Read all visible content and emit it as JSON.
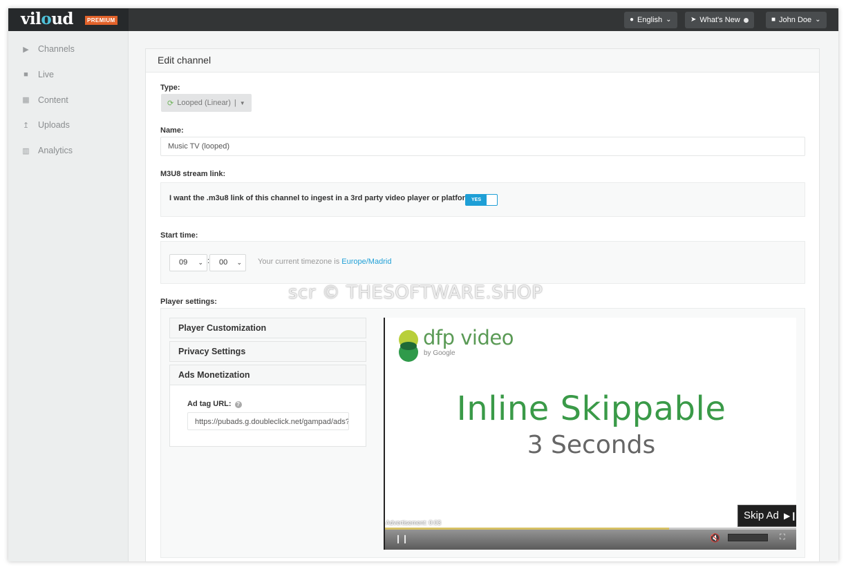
{
  "header": {
    "logo_text_1": "vil",
    "logo_text_2": "o",
    "logo_text_3": "ud",
    "premium_badge": "PREMIUM",
    "language_label": "English",
    "whats_new_label": "What's New",
    "user_label": "John Doe"
  },
  "sidebar": {
    "items": [
      {
        "label": "Channels",
        "icon": "play-icon"
      },
      {
        "label": "Live",
        "icon": "video-camera-icon"
      },
      {
        "label": "Content",
        "icon": "grid-icon"
      },
      {
        "label": "Uploads",
        "icon": "upload-icon"
      },
      {
        "label": "Analytics",
        "icon": "bar-chart-icon"
      }
    ]
  },
  "form": {
    "title": "Edit channel",
    "type_label": "Type:",
    "type_value": "Looped (Linear)",
    "type_separator": "|",
    "name_label": "Name:",
    "name_value": "Music TV (looped)",
    "m3u8_label": "M3U8 stream link:",
    "m3u8_question": "I want the .m3u8 link of this channel to ingest in a 3rd party video player or platform:",
    "m3u8_toggle": "YES",
    "start_label": "Start time:",
    "hour_value": "09",
    "minute_value": "00",
    "time_sep": ":",
    "tz_prefix": "Your current timezone is",
    "tz_link": "Europe/Madrid",
    "player_label": "Player settings:"
  },
  "player_settings": {
    "sections": [
      "Player Customization",
      "Privacy Settings",
      "Ads Monetization"
    ],
    "ad_tag_label": "Ad tag URL:",
    "ad_tag_value": "https://pubads.g.doubleclick.net/gampad/ads?"
  },
  "video": {
    "dfp_text": "dfp video",
    "dfp_by": "by Google",
    "headline": "Inline Skippable",
    "subline": "3 Seconds",
    "skip_label": "Skip Ad",
    "advertisement_text": "Advertisement: 0:03",
    "progress": 0.69,
    "colors": {
      "headline": "#3a9a48",
      "accent": "#1e9fd6"
    }
  },
  "watermark": "scr © THESOFTWARE.SHOP"
}
